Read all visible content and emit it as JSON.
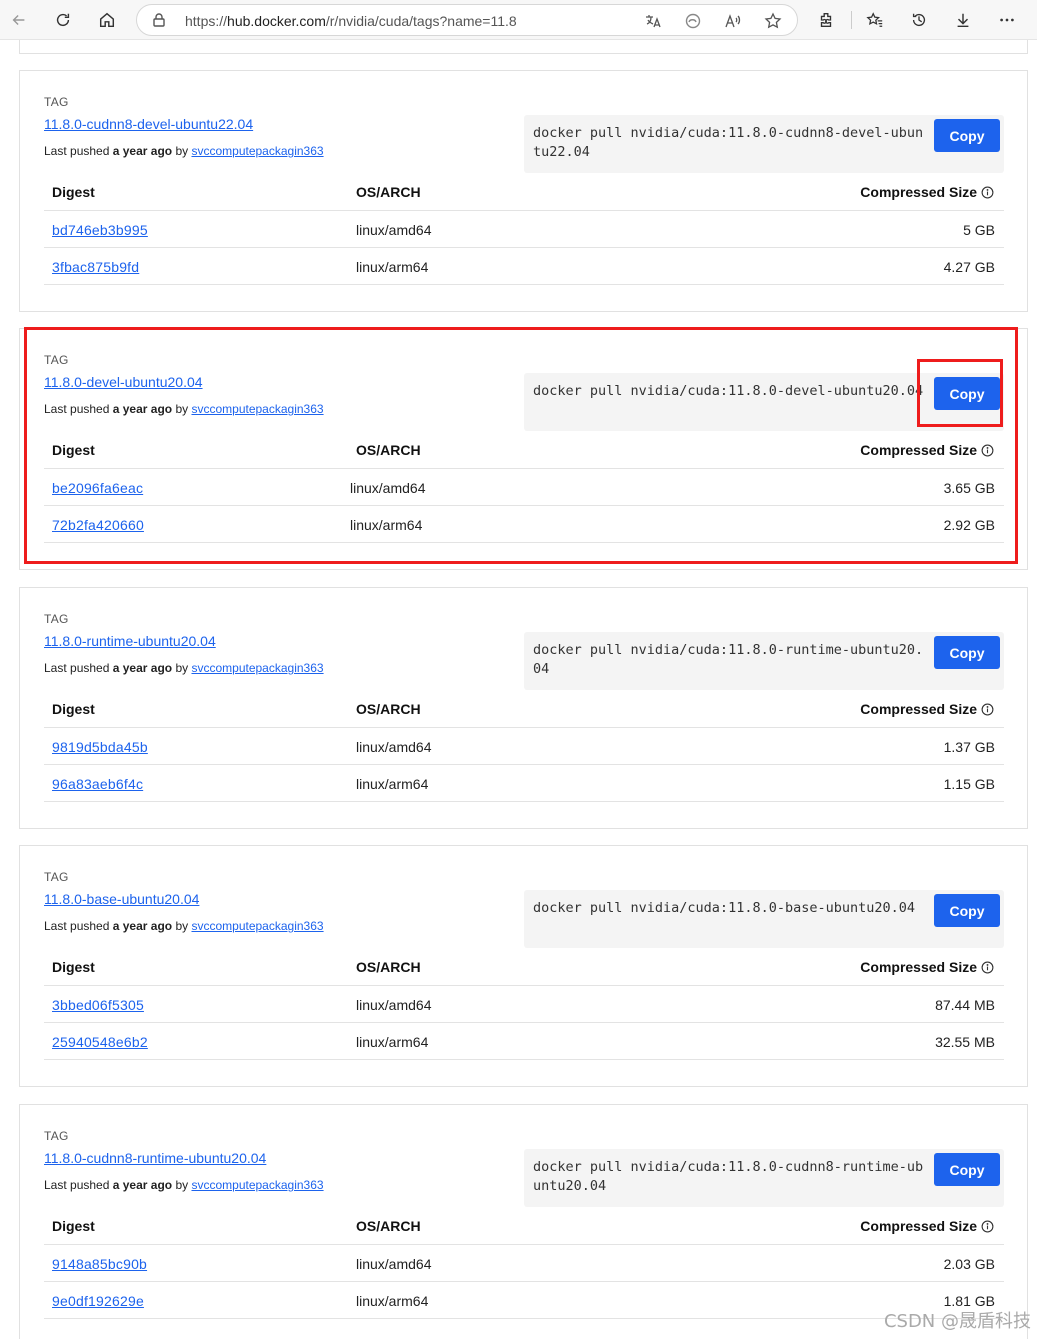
{
  "browser": {
    "url_prefix": "https://",
    "url_host": "hub.docker.com",
    "url_path": "/r/nvidia/cuda/tags?name=11.8"
  },
  "labels": {
    "tag": "TAG",
    "last_pushed_prefix": "Last pushed",
    "last_pushed_when": "a year ago",
    "by": "by",
    "digest_header": "Digest",
    "os_arch_header": "OS/ARCH",
    "compressed_size_header": "Compressed Size",
    "copy": "Copy"
  },
  "tags": [
    {
      "name": "11.8.0-cudnn8-devel-ubuntu22.04",
      "pusher": "svccomputepackagin363",
      "command": "docker pull nvidia/cuda:11.8.0-cudnn8-devel-ubuntu22.04",
      "images": [
        {
          "digest": "bd746eb3b995",
          "arch": "linux/amd64",
          "size": "5 GB"
        },
        {
          "digest": "3fbac875b9fd",
          "arch": "linux/arm64",
          "size": "4.27 GB"
        }
      ]
    },
    {
      "name": "11.8.0-devel-ubuntu20.04",
      "pusher": "svccomputepackagin363",
      "command": "docker pull nvidia/cuda:11.8.0-devel-ubuntu20.04",
      "images": [
        {
          "digest": "be2096fa6eac",
          "arch": "linux/amd64",
          "size": "3.65 GB"
        },
        {
          "digest": "72b2fa420660",
          "arch": "linux/arm64",
          "size": "2.92 GB"
        }
      ]
    },
    {
      "name": "11.8.0-runtime-ubuntu20.04",
      "pusher": "svccomputepackagin363",
      "command": "docker pull nvidia/cuda:11.8.0-runtime-ubuntu20.04",
      "images": [
        {
          "digest": "9819d5bda45b",
          "arch": "linux/amd64",
          "size": "1.37 GB"
        },
        {
          "digest": "96a83aeb6f4c",
          "arch": "linux/arm64",
          "size": "1.15 GB"
        }
      ]
    },
    {
      "name": "11.8.0-base-ubuntu20.04",
      "pusher": "svccomputepackagin363",
      "command": "docker pull nvidia/cuda:11.8.0-base-ubuntu20.04",
      "images": [
        {
          "digest": "3bbed06f5305",
          "arch": "linux/amd64",
          "size": "87.44 MB"
        },
        {
          "digest": "25940548e6b2",
          "arch": "linux/arm64",
          "size": "32.55 MB"
        }
      ]
    },
    {
      "name": "11.8.0-cudnn8-runtime-ubuntu20.04",
      "pusher": "svccomputepackagin363",
      "command": "docker pull nvidia/cuda:11.8.0-cudnn8-runtime-ubuntu20.04",
      "images": [
        {
          "digest": "9148a85bc90b",
          "arch": "linux/amd64",
          "size": "2.03 GB"
        },
        {
          "digest": "9e0df192629e",
          "arch": "linux/arm64",
          "size": "1.81 GB"
        }
      ]
    }
  ],
  "watermark": "CSDN @晟盾科技"
}
